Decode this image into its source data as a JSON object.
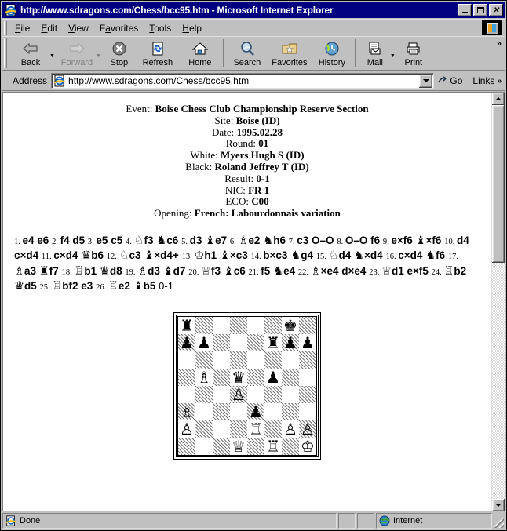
{
  "window": {
    "title": "http://www.sdragons.com/Chess/bcc95.htm - Microsoft Internet Explorer",
    "title_icon": "ie-document-icon",
    "minimize_label": "_",
    "maximize_label": "□",
    "close_label": "✕"
  },
  "menu": {
    "items": [
      {
        "label": "File",
        "accel": "F"
      },
      {
        "label": "Edit",
        "accel": "E"
      },
      {
        "label": "View",
        "accel": "V"
      },
      {
        "label": "Favorites",
        "accel": "a"
      },
      {
        "label": "Tools",
        "accel": "T"
      },
      {
        "label": "Help",
        "accel": "H"
      }
    ]
  },
  "toolbar": {
    "buttons": [
      {
        "label": "Back",
        "icon": "back-arrow-icon",
        "enabled": true,
        "has_dropdown": true
      },
      {
        "label": "Forward",
        "icon": "forward-arrow-icon",
        "enabled": false,
        "has_dropdown": true
      },
      {
        "label": "Stop",
        "icon": "stop-icon",
        "enabled": true
      },
      {
        "label": "Refresh",
        "icon": "refresh-icon",
        "enabled": true
      },
      {
        "label": "Home",
        "icon": "home-icon",
        "enabled": true
      },
      {
        "label": "Search",
        "icon": "search-icon",
        "enabled": true
      },
      {
        "label": "Favorites",
        "icon": "favorites-star-icon",
        "enabled": true
      },
      {
        "label": "History",
        "icon": "history-clock-icon",
        "enabled": true
      },
      {
        "label": "Mail",
        "icon": "mail-icon",
        "enabled": true,
        "has_dropdown": true
      },
      {
        "label": "Print",
        "icon": "printer-icon",
        "enabled": true
      }
    ],
    "overflow_label": "»"
  },
  "address": {
    "label": "Address",
    "value": "http://www.sdragons.com/Chess/bcc95.htm",
    "placeholder": "",
    "icon": "ie-document-icon",
    "go_label": "Go",
    "go_icon": "go-arrow-icon",
    "links_label": "Links",
    "links_overflow": "»"
  },
  "game_headers": [
    {
      "key": "Event:",
      "value": "Boise Chess Club Championship Reserve Section"
    },
    {
      "key": "Site:",
      "value": "Boise (ID)"
    },
    {
      "key": "Date:",
      "value": "1995.02.28"
    },
    {
      "key": "Round:",
      "value": "01"
    },
    {
      "key": "White:",
      "value": "Myers Hugh S (ID)"
    },
    {
      "key": "Black:",
      "value": "Roland Jeffrey T (ID)"
    },
    {
      "key": "Result:",
      "value": "0-1"
    },
    {
      "key": "NIC:",
      "value": "FR 1"
    },
    {
      "key": "ECO:",
      "value": "C00"
    },
    {
      "key": "Opening:",
      "value": "French: Labourdonnais variation"
    }
  ],
  "moves": [
    {
      "n": "1.",
      "w": "e4",
      "b": "e6"
    },
    {
      "n": "2.",
      "w": "f4",
      "b": "d5"
    },
    {
      "n": "3.",
      "w": "e5",
      "b": "c5"
    },
    {
      "n": "4.",
      "w": "♘f3",
      "b": "♞c6"
    },
    {
      "n": "5.",
      "w": "d3",
      "b": "♝e7"
    },
    {
      "n": "6.",
      "w": "♗e2",
      "b": "♞h6"
    },
    {
      "n": "7.",
      "w": "c3",
      "b": "O–O"
    },
    {
      "n": "8.",
      "w": "O–O",
      "b": "f6"
    },
    {
      "n": "9.",
      "w": "e×f6",
      "b": "♝×f6"
    },
    {
      "n": "10.",
      "w": "d4",
      "b": "c×d4"
    },
    {
      "n": "11.",
      "w": "c×d4",
      "b": "♛b6"
    },
    {
      "n": "12.",
      "w": "♘c3",
      "b": "♝×d4+"
    },
    {
      "n": "13.",
      "w": "♔h1",
      "b": "♝×c3"
    },
    {
      "n": "14.",
      "w": "b×c3",
      "b": "♞g4"
    },
    {
      "n": "15.",
      "w": "♘d4",
      "b": "♞×d4"
    },
    {
      "n": "16.",
      "w": "c×d4",
      "b": "♞f6"
    },
    {
      "n": "17.",
      "w": "♗a3",
      "b": "♜f7"
    },
    {
      "n": "18.",
      "w": "♖b1",
      "b": "♛d8"
    },
    {
      "n": "19.",
      "w": "♗d3",
      "b": "♝d7"
    },
    {
      "n": "20.",
      "w": "♕f3",
      "b": "♝c6"
    },
    {
      "n": "21.",
      "w": "f5",
      "b": "♞e4"
    },
    {
      "n": "22.",
      "w": "♗×e4",
      "b": "d×e4"
    },
    {
      "n": "23.",
      "w": "♕d1",
      "b": "e×f5"
    },
    {
      "n": "24.",
      "w": "♖b2",
      "b": "♛d5"
    },
    {
      "n": "25.",
      "w": "♖bf2",
      "b": "e3"
    },
    {
      "n": "26.",
      "w": "♖e2",
      "b": "♝b5"
    }
  ],
  "moves_result": "0-1",
  "chess_board": {
    "orientation": "white-bottom",
    "ranks": [
      [
        "r",
        "",
        "",
        "",
        "",
        "",
        "k",
        ""
      ],
      [
        "p",
        "p",
        "",
        "",
        "",
        "r",
        "p",
        "p"
      ],
      [
        "",
        "",
        "",
        "",
        "",
        "",
        "",
        ""
      ],
      [
        "",
        "B",
        "",
        "q",
        "",
        "p",
        "",
        ""
      ],
      [
        "",
        "",
        "",
        "P",
        "",
        "",
        "",
        ""
      ],
      [
        "B",
        "",
        "",
        "",
        "p",
        "",
        "",
        ""
      ],
      [
        "P",
        "",
        "",
        "",
        "R",
        "",
        "P",
        "P"
      ],
      [
        "",
        "",
        "",
        "Q",
        "",
        "R",
        "",
        "K"
      ]
    ],
    "glyphs": {
      "K": "♔",
      "Q": "♕",
      "R": "♖",
      "B": "♗",
      "N": "♘",
      "P": "♙",
      "k": "♚",
      "q": "♛",
      "r": "♜",
      "b": "♝",
      "n": "♞",
      "p": "♟"
    }
  },
  "status": {
    "message": "Done",
    "message_icon": "ie-document-icon",
    "zone": "Internet",
    "zone_icon": "globe-icon"
  },
  "colors": {
    "titlebar": "#000080",
    "chrome": "#c0c0c0",
    "page_bg": "#ffffff",
    "text": "#000000"
  }
}
